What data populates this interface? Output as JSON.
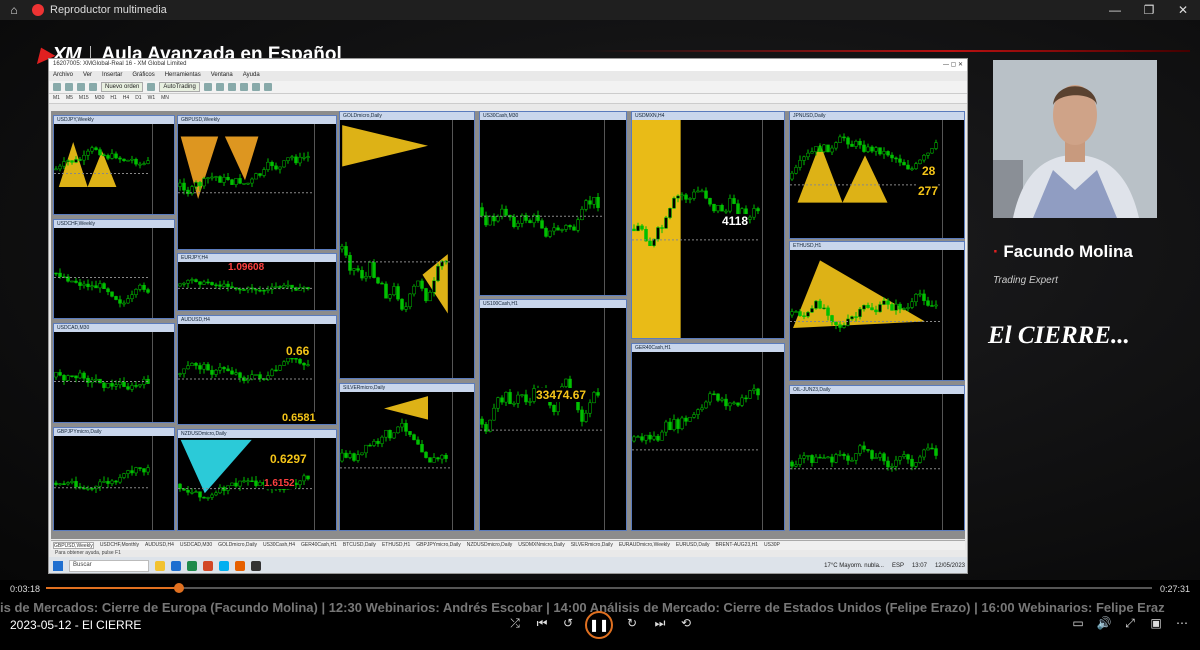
{
  "window": {
    "title": "Reproductor multimedia",
    "buttons": [
      "—",
      "❐",
      "✕"
    ]
  },
  "brand": {
    "logo": "XM",
    "title": "Aula Avanzada en Español"
  },
  "mt4": {
    "title": "16207005: XMGlobal-Real 16 - XM Global Limited",
    "menu": [
      "Archivo",
      "Ver",
      "Insertar",
      "Gráficos",
      "Herramientas",
      "Ventana",
      "Ayuda"
    ],
    "toolbar": {
      "new_order": "Nuevo orden",
      "autotrading": "AutoTrading"
    },
    "timeframes": [
      "M1",
      "M5",
      "M15",
      "M30",
      "H1",
      "H4",
      "D1",
      "W1",
      "MN"
    ],
    "charts": [
      {
        "title": "USDJPY,Weekly"
      },
      {
        "title": "GBPUSD,Weekly"
      },
      {
        "title": "GOLDmicro,Daily"
      },
      {
        "title": "US30Cash,M30"
      },
      {
        "title": "USDMXN,H4"
      },
      {
        "title": "JPNUSD,Daily"
      },
      {
        "title": "USDCHF,Weekly"
      },
      {
        "title": "EURJPY,H4"
      },
      {
        "title": "ETHUSD,H1"
      },
      {
        "title": "USDCAD,M30"
      },
      {
        "title": "AUDUSD,H4"
      },
      {
        "title": "US100Cash,H1"
      },
      {
        "title": "SILVERmicro,Daily"
      },
      {
        "title": "GER40Cash,H1"
      },
      {
        "title": "GBPJPYmicro,Daily"
      },
      {
        "title": "NZDUSDmicro,Daily"
      },
      {
        "title": "OIL-JUN23,Daily"
      }
    ],
    "big_values": [
      "4118",
      "28",
      "277",
      "33474.67",
      "0.66",
      "0.6581",
      "0.6297",
      "1.6152",
      "1.09608"
    ],
    "footer_tabs": [
      "GBPUSD,Weekly",
      "USDCHF,Monthly",
      "AUDUSD,H4",
      "USDCAD,M30",
      "GOLDmicro,Daily",
      "US30Cash,H4",
      "GER40Cash,H1",
      "BTCUSD,Daily",
      "ETHUSD,H1",
      "GBPJPYmicro,Daily",
      "NZDUSDmicro,Daily",
      "USDMXNmicro,Daily",
      "SILVERmicro,Daily",
      "EURAUDmicro,Weekly",
      "EURUSD,Daily",
      "BRENT-AUG23,H1",
      "US30P"
    ],
    "status_hint": "Para obtener ayuda, pulse F1",
    "taskbar": {
      "search": "Buscar",
      "weather": "17°C  Mayorm. nubla...",
      "time": "13:07",
      "date": "12/05/2023",
      "lang": "ESP"
    }
  },
  "speaker": {
    "name": "Facundo Molina",
    "role": "Trading Expert"
  },
  "overlay_text": "El CIERRE...",
  "player": {
    "current_time": "0:03:18",
    "total_time": "0:27:31",
    "progress_fraction": 0.12,
    "ticker": "is de Mercados: Cierre de Europa (Facundo Molina) | 12:30 Webinarios: Andrés Escobar | 14:00 Análisis de Mercado: Cierre de Estados Unidos (Felipe Erazo) | 16:00 Webinarios: Felipe Eraz",
    "video_title": "2023-05-12 - El CIERRE"
  },
  "colors": {
    "accent": "#e07020",
    "brand_red": "#e02020",
    "candle_up": "#00c000",
    "highlight": "#f5c518"
  }
}
